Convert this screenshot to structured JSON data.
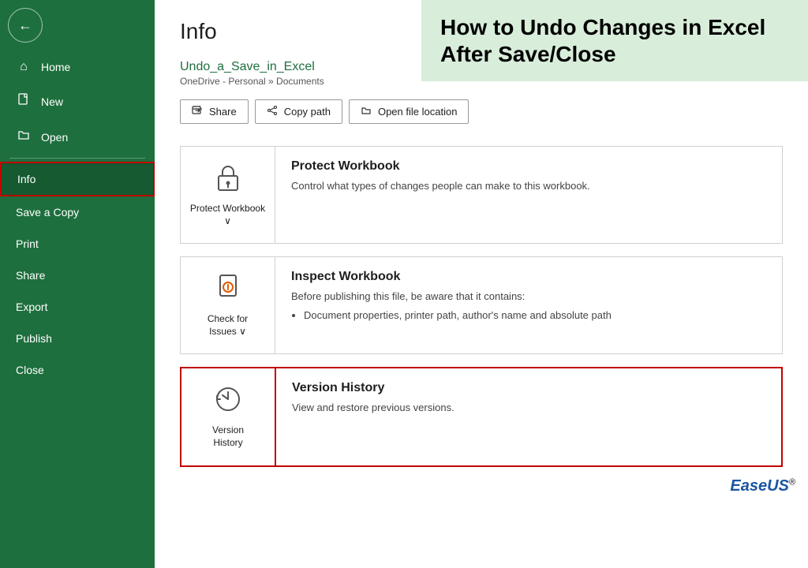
{
  "sidebar": {
    "back_icon": "←",
    "items": [
      {
        "label": "Home",
        "icon": "⌂",
        "name": "home",
        "active": false
      },
      {
        "label": "New",
        "icon": "📄",
        "name": "new",
        "active": false
      },
      {
        "label": "Open",
        "icon": "📁",
        "name": "open",
        "active": false
      },
      {
        "label": "Info",
        "icon": "",
        "name": "info",
        "active": true
      },
      {
        "label": "Save a Copy",
        "icon": "",
        "name": "save-copy",
        "active": false
      },
      {
        "label": "Print",
        "icon": "",
        "name": "print",
        "active": false
      },
      {
        "label": "Share",
        "icon": "",
        "name": "share",
        "active": false
      },
      {
        "label": "Export",
        "icon": "",
        "name": "export",
        "active": false
      },
      {
        "label": "Publish",
        "icon": "",
        "name": "publish",
        "active": false
      },
      {
        "label": "Close",
        "icon": "",
        "name": "close",
        "active": false
      }
    ]
  },
  "main": {
    "page_title": "Info",
    "file_name": "Undo_a_Save_in_Excel",
    "file_path": "OneDrive - Personal » Documents",
    "buttons": [
      {
        "label": "Share",
        "icon": "⬆",
        "name": "share-btn"
      },
      {
        "label": "Copy path",
        "icon": "🔗",
        "name": "copy-path-btn"
      },
      {
        "label": "Open file location",
        "icon": "📂",
        "name": "open-location-btn"
      }
    ],
    "sections": [
      {
        "name": "protect-workbook",
        "icon_label": "Protect\nWorkbook ∨",
        "title": "Protect Workbook",
        "desc": "Control what types of changes people can make to this workbook.",
        "highlighted": false,
        "has_list": false,
        "list_items": []
      },
      {
        "name": "inspect-workbook",
        "icon_label": "Check for\nIssues ∨",
        "title": "Inspect Workbook",
        "desc": "Before publishing this file, be aware that it contains:",
        "highlighted": false,
        "has_list": true,
        "list_items": [
          "Document properties, printer path, author's name and absolute path"
        ]
      },
      {
        "name": "version-history",
        "icon_label": "Version\nHistory",
        "title": "Version History",
        "desc": "View and restore previous versions.",
        "highlighted": true,
        "has_list": false,
        "list_items": []
      }
    ]
  },
  "banner": {
    "text": "How to Undo Changes in Excel After Save/Close"
  },
  "branding": {
    "name": "EaseUS",
    "trademark": "®"
  }
}
